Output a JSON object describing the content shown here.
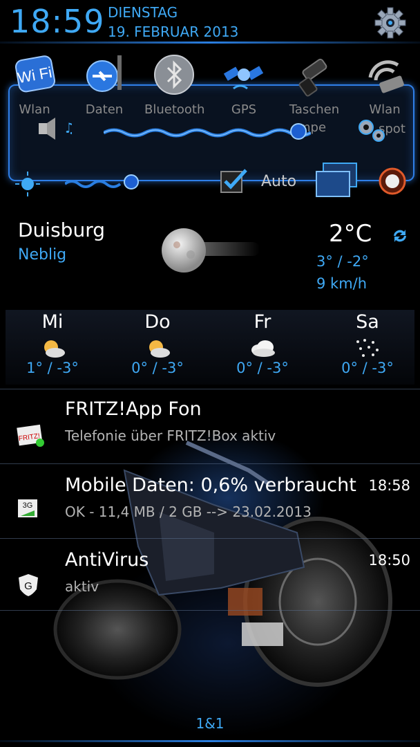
{
  "status": {
    "time": "18:59",
    "weekday": "DIENSTAG",
    "date": "19. FEBRUAR 2013",
    "settings_icon": "gear-icon"
  },
  "toggles": [
    {
      "label": "Wlan",
      "icon": "wifi-icon"
    },
    {
      "label": "Daten",
      "icon": "mobile-data-icon"
    },
    {
      "label": "Bluetooth",
      "icon": "bluetooth-icon"
    },
    {
      "label": "GPS",
      "icon": "gps-satellite-icon"
    },
    {
      "label": "Taschen",
      "icon": "flashlight-icon"
    },
    {
      "label": "Wlan",
      "icon": "wifi-hotspot-icon"
    }
  ],
  "toggle_partial_labels": {
    "taschenlampe_rest": "mpe",
    "hotspot_rest": "spot"
  },
  "brightness": {
    "auto_label": "Auto",
    "auto_checked": true
  },
  "weather": {
    "city": "Duisburg",
    "condition": "Neblig",
    "temperature": "2°C",
    "high_low": "3° / -2°",
    "wind": "9 km/h",
    "forecast": [
      {
        "day": "Mi",
        "temps": "1° / -3°",
        "icon": "sun-cloud-icon"
      },
      {
        "day": "Do",
        "temps": "0° / -3°",
        "icon": "sun-cloud-icon"
      },
      {
        "day": "Fr",
        "temps": "0° / -3°",
        "icon": "cloud-icon"
      },
      {
        "day": "Sa",
        "temps": "0° / -3°",
        "icon": "snow-icon"
      }
    ]
  },
  "notifications": [
    {
      "title": "FRITZ!App Fon",
      "text": "Telefonie über FRITZ!Box aktiv",
      "time": "",
      "icon": "fritz-icon"
    },
    {
      "title": "Mobile Daten: 0,6% verbraucht",
      "text": "OK - 11,4 MB / 2 GB --> 23.02.2013",
      "time": "18:58",
      "icon": "3g-icon"
    },
    {
      "title": "AntiVirus",
      "text": "aktiv",
      "time": "18:50",
      "icon": "shield-icon"
    }
  ],
  "carrier": "1&1",
  "colors": {
    "accent": "#3fa9f5",
    "frame": "#2f7fe8"
  }
}
